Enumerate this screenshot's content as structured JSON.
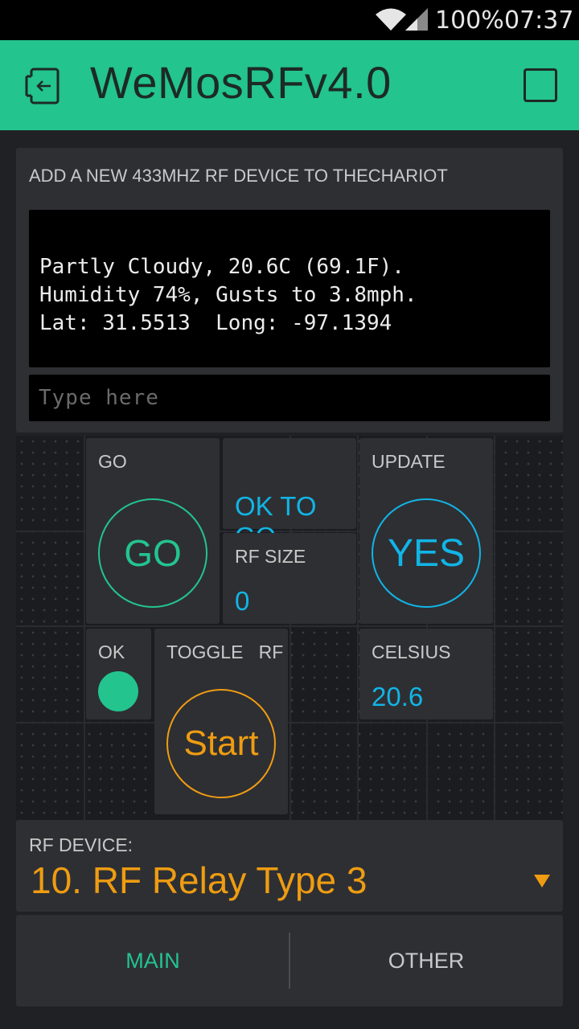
{
  "status_bar": {
    "battery": "100%",
    "time": "07:37"
  },
  "header": {
    "title": "WeMosRFv4.0",
    "back_icon": "exit-project-icon",
    "settings_icon": "stop-square-icon"
  },
  "terminal": {
    "title": "ADD A NEW 433MHZ RF DEVICE TO THECHARIOT",
    "lines": [
      "Partly Cloudy, 20.6C (69.1F).",
      "Humidity 74%, Gusts to 3.8mph.",
      "Lat: 31.5513  Long: -97.1394"
    ],
    "input_placeholder": "Type here"
  },
  "widgets": {
    "go": {
      "label": "GO",
      "button_text": "GO",
      "color": "#23c48e"
    },
    "status": {
      "value": "OK TO GO",
      "color": "#11b5e6"
    },
    "rf_size": {
      "label": "RF SIZE",
      "value": "0",
      "color": "#11b5e6"
    },
    "update": {
      "label": "UPDATE",
      "button_text": "YES",
      "color": "#11b5e6"
    },
    "ok_led": {
      "label": "OK",
      "color": "#23c48e"
    },
    "toggle_rf": {
      "label": "TOGGLE   RF",
      "button_text": "Start",
      "color": "#ee9c12"
    },
    "celsius": {
      "label": "CELSIUS",
      "value": "20.6",
      "color": "#11b5e6"
    }
  },
  "rf_device": {
    "label": "RF DEVICE:",
    "selected": "10. RF Relay Type 3",
    "color": "#ee9c12"
  },
  "tabs": [
    {
      "label": "MAIN",
      "active": true
    },
    {
      "label": "OTHER",
      "active": false
    }
  ]
}
